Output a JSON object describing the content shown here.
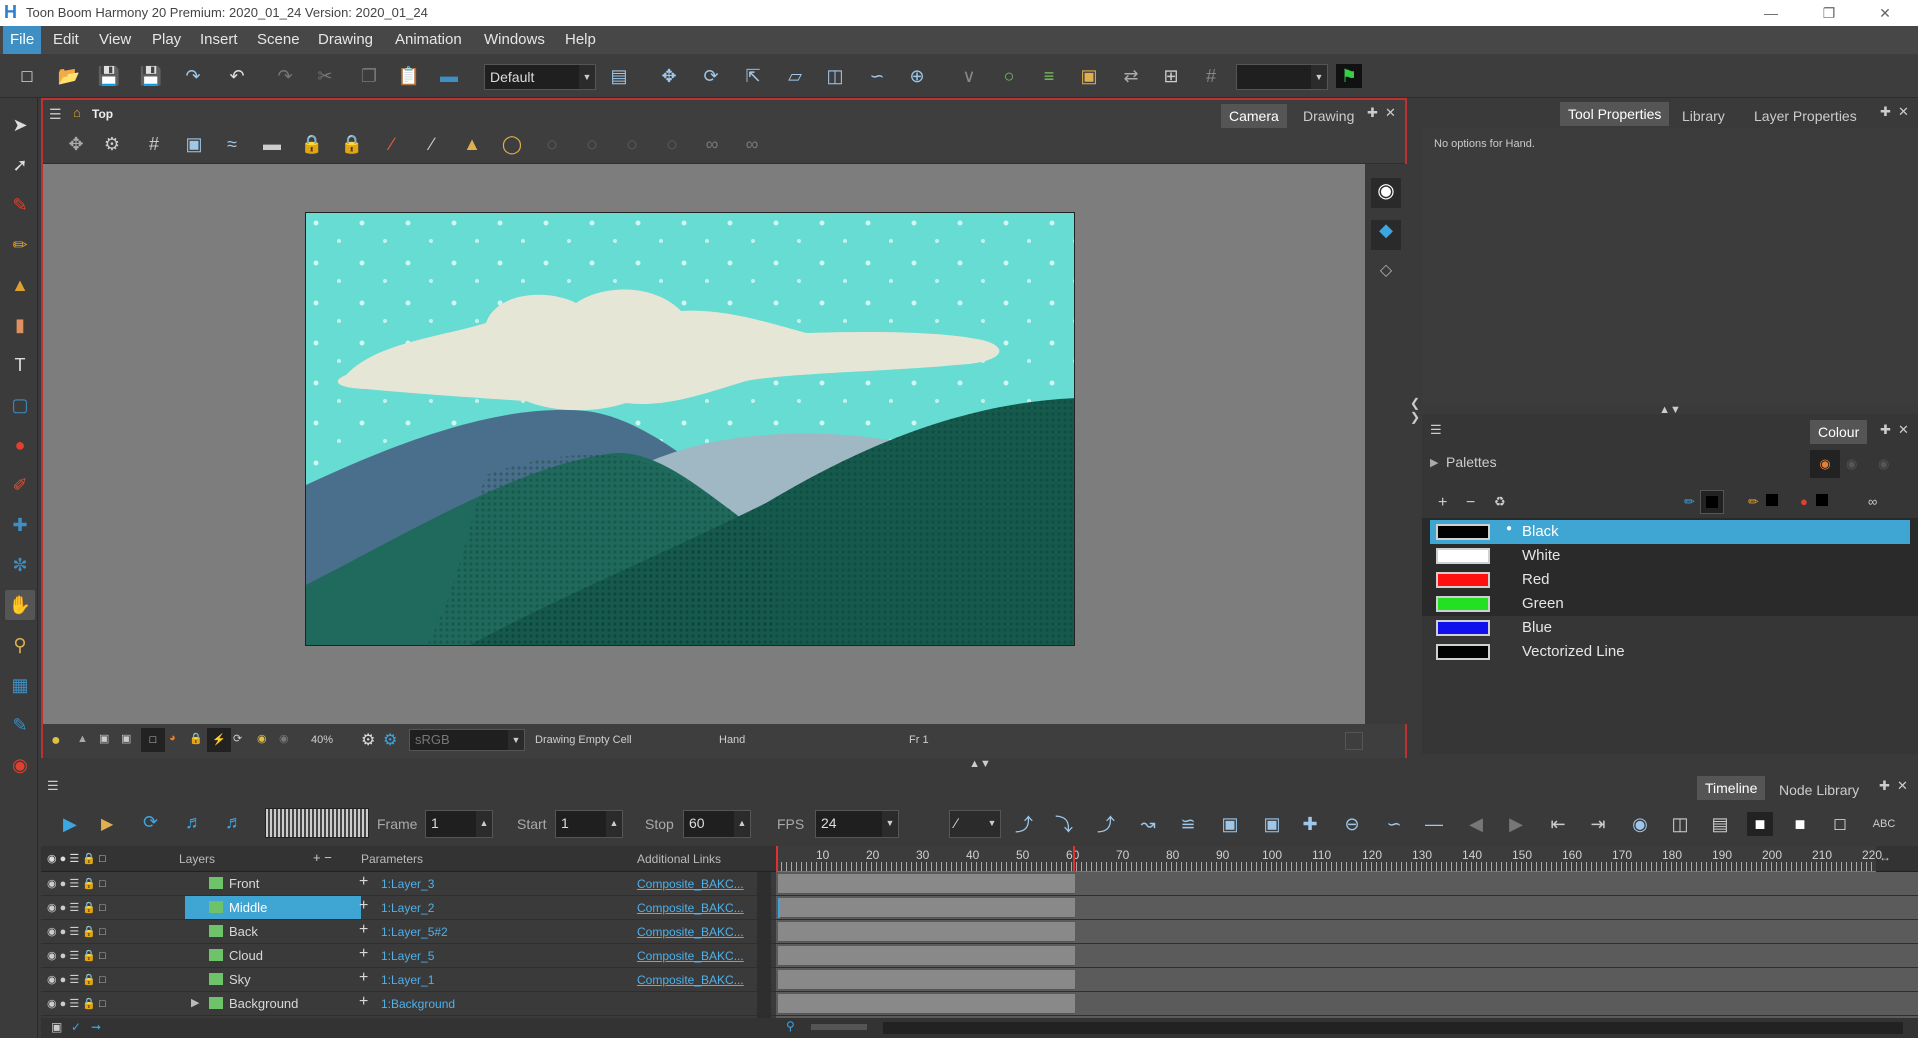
{
  "app": {
    "title": "Toon Boom Harmony 20 Premium: 2020_01_24 Version: 2020_01_24"
  },
  "menu": [
    "File",
    "Edit",
    "View",
    "Play",
    "Insert",
    "Scene",
    "Drawing",
    "Animation",
    "Windows",
    "Help"
  ],
  "toolbar": {
    "workspace": "Default"
  },
  "viewpanel": {
    "title": "Top",
    "tabs": [
      "Camera",
      "Drawing"
    ],
    "status": {
      "zoom": "40%",
      "colorspace": "sRGB",
      "mode": "Drawing Empty Cell",
      "tool": "Hand",
      "frame": "Fr 1"
    }
  },
  "rightpanel": {
    "tabs": [
      "Tool Properties",
      "Library",
      "Layer Properties"
    ],
    "message": "No options for Hand."
  },
  "colour": {
    "tab": "Colour",
    "palettes_label": "Palettes",
    "swatches": [
      {
        "name": "Black",
        "color": "#000000",
        "selected": true
      },
      {
        "name": "White",
        "color": "#ffffff"
      },
      {
        "name": "Red",
        "color": "#ff1010"
      },
      {
        "name": "Green",
        "color": "#22e022"
      },
      {
        "name": "Blue",
        "color": "#1010ee"
      },
      {
        "name": "Vectorized Line",
        "color": "#000000"
      }
    ]
  },
  "timeline": {
    "tabs": [
      "Timeline",
      "Node Library"
    ],
    "frame_label": "Frame",
    "frame": "1",
    "start_label": "Start",
    "start": "1",
    "stop_label": "Stop",
    "stop": "60",
    "fps_label": "FPS",
    "fps": "24",
    "headers": {
      "layers": "Layers",
      "parameters": "Parameters",
      "links": "Additional Links"
    },
    "ruler": [
      "10",
      "20",
      "30",
      "40",
      "50",
      "60",
      "70",
      "80",
      "90",
      "100",
      "110",
      "120",
      "130",
      "140",
      "150",
      "160",
      "170",
      "180",
      "190",
      "200",
      "210",
      "220"
    ],
    "layers": [
      {
        "name": "Front",
        "param": "1:Layer_3",
        "link": "Composite_BAKC..."
      },
      {
        "name": "Middle",
        "param": "1:Layer_2",
        "link": "Composite_BAKC...",
        "selected": true
      },
      {
        "name": "Back",
        "param": "1:Layer_5#2",
        "link": "Composite_BAKC..."
      },
      {
        "name": "Cloud",
        "param": "1:Layer_5",
        "link": "Composite_BAKC..."
      },
      {
        "name": "Sky",
        "param": "1:Layer_1",
        "link": "Composite_BAKC..."
      },
      {
        "name": "Background",
        "param": "1:Background",
        "link": ""
      }
    ]
  }
}
